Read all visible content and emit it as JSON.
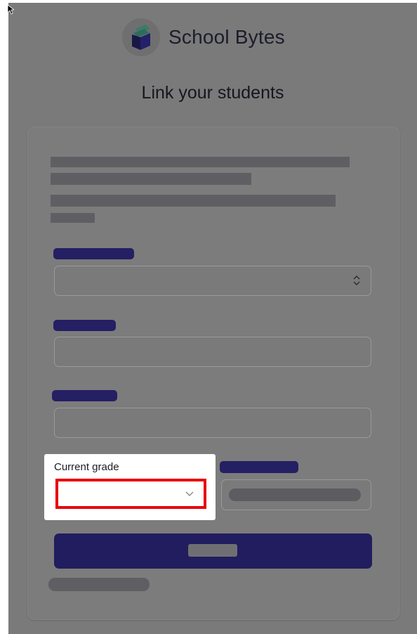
{
  "app": {
    "name": "School Bytes"
  },
  "page": {
    "title": "Link your students"
  },
  "form": {
    "current_grade": {
      "label": "Current grade",
      "value": ""
    }
  },
  "colors": {
    "brand_navy": "#211d5e",
    "highlight_border": "#e8000b",
    "overlay_gray": "#7a7a7a"
  },
  "icons": {
    "logo": "school-bytes-book-icon",
    "stepper": "updown-chevron-icon",
    "dropdown": "chevron-down-icon",
    "cursor": "mouse-pointer-icon"
  }
}
